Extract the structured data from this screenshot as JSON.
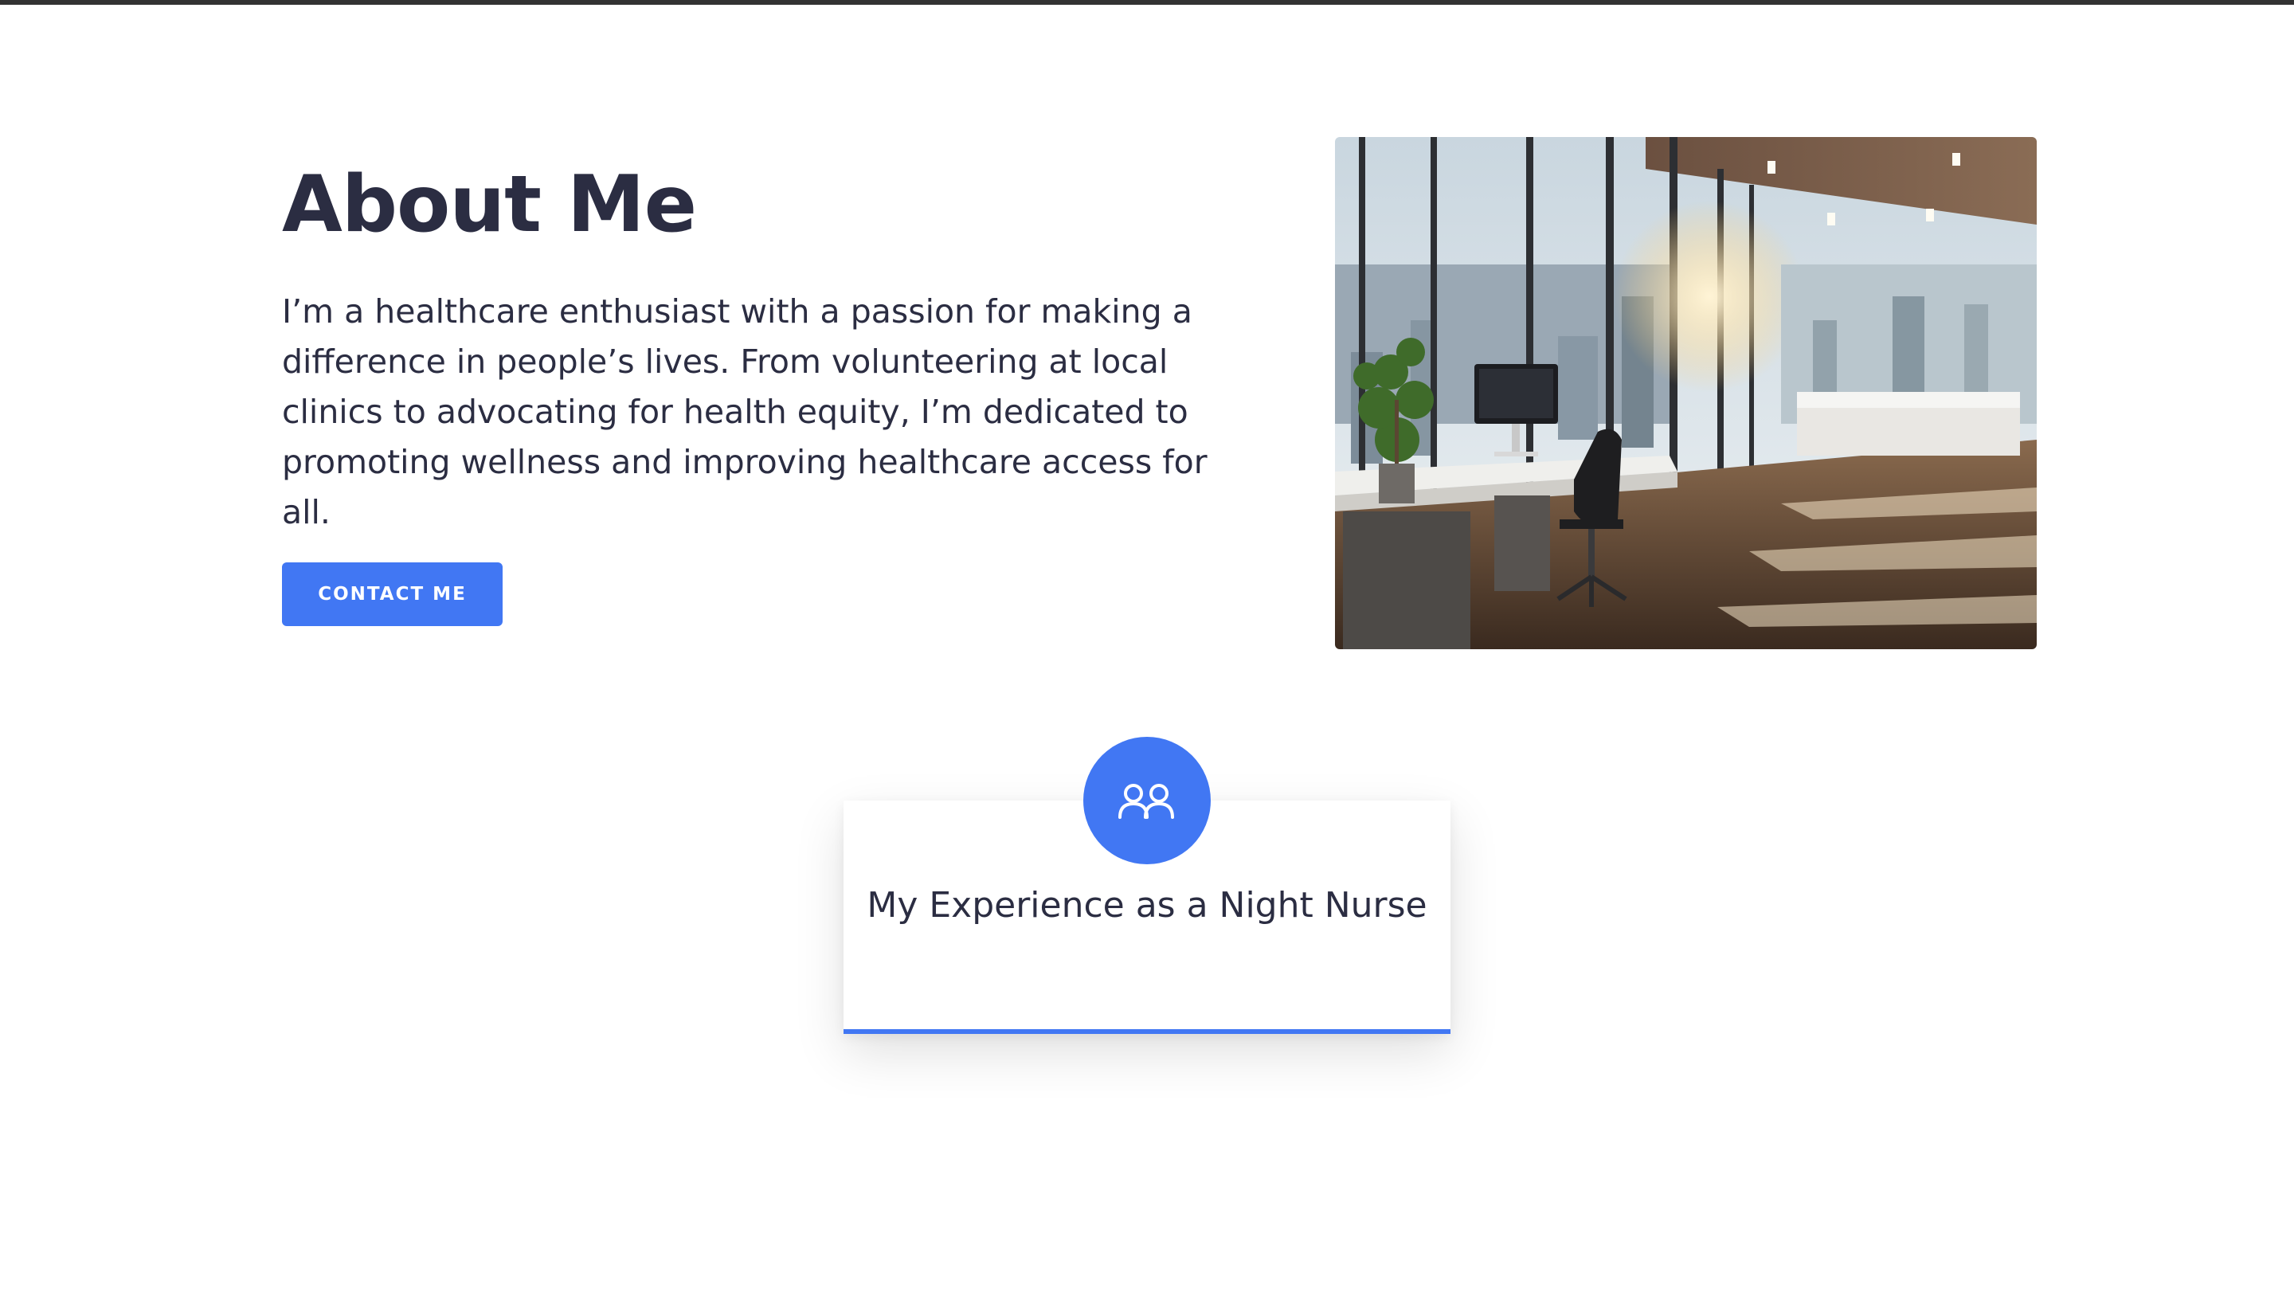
{
  "about": {
    "heading": "About Me",
    "body": "I’m a healthcare enthusiast with a passion for making a difference in people’s lives. From volunteering at local clinics to advocating for health equity, I’m dedicated to promoting wellness and improving healthcare access for all.",
    "contact_button": "CONTACT ME"
  },
  "feature_card": {
    "icon": "users-icon",
    "title": "My Experience as a Night Nurse"
  },
  "colors": {
    "accent": "#4177f3",
    "text": "#2b2d42",
    "top_bar": "#333333"
  }
}
